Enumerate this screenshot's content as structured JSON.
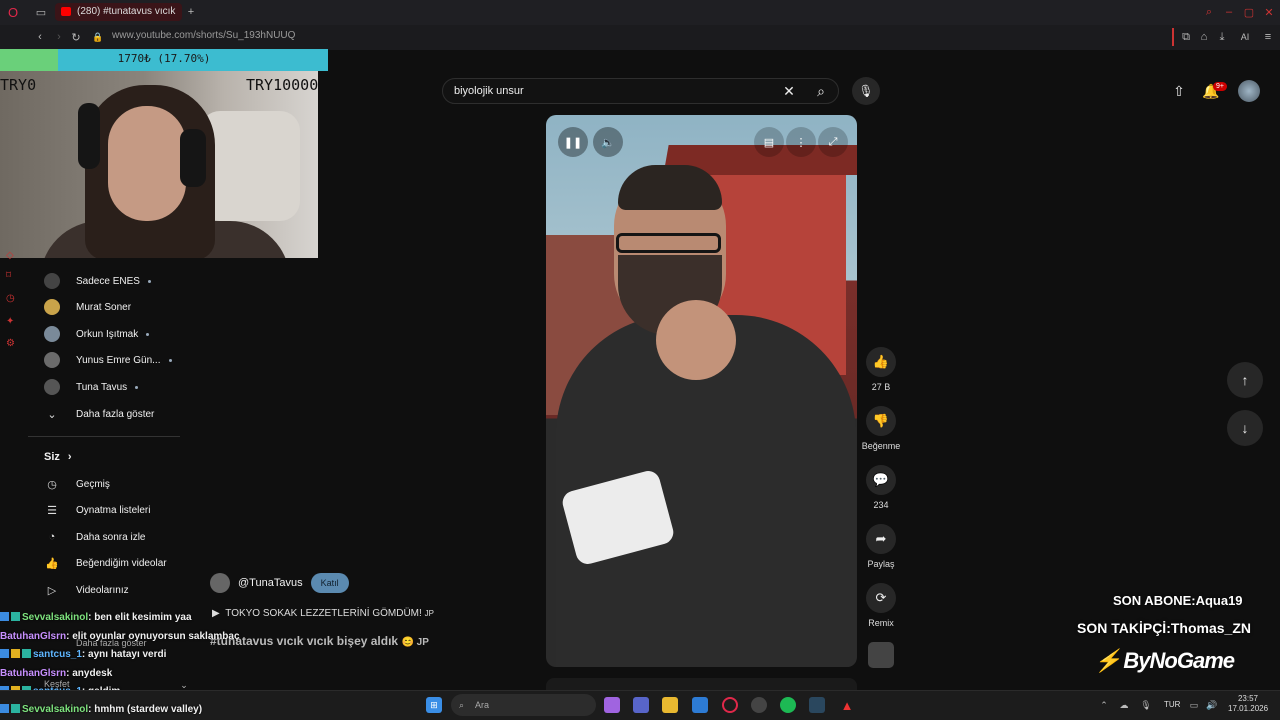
{
  "browser": {
    "tab_title": "(280) #tunatavus vıcık",
    "url": "www.youtube.com/shorts/Su_193hNUUQ",
    "ai_label": "AI"
  },
  "goal": {
    "progress_text": "1770₺ (17.70%)",
    "progress_fraction": 0.177,
    "start_label": "TRY0",
    "end_label": "TRY10000"
  },
  "search": {
    "query": "biyolojik unsur"
  },
  "header": {
    "notification_badge": "9+"
  },
  "sidebar": {
    "subscriptions": [
      {
        "name": "Sadece ENES",
        "dot": true
      },
      {
        "name": "Murat Soner",
        "dot": false
      },
      {
        "name": "Orkun Işıtmak",
        "dot": true
      },
      {
        "name": "Yunus Emre Gün...",
        "dot": true
      },
      {
        "name": "Tuna Tavus",
        "dot": true
      }
    ],
    "show_more": "Daha fazla göster",
    "you_heading": "Siz",
    "you_items": [
      "Geçmiş",
      "Oynatma listeleri",
      "Daha sonra izle",
      "Beğendiğim videolar",
      "Videolarınız"
    ],
    "show_more_2": "Daha fazla göster",
    "explore": "Keşfet"
  },
  "short": {
    "channel": "@TunaTavus",
    "join_label": "Katıl",
    "linked_video": "TOKYO SOKAK LEZZETLERİNİ GÖMDÜM!",
    "title": "#tunatavus vıcık vıcık bişey aldık",
    "title_suffix": "😊 JP",
    "linked_suffix": "JP"
  },
  "actions": {
    "likes": "27 B",
    "dislike_label": "Beğenme",
    "comments": "234",
    "share_label": "Paylaş",
    "remix_label": "Remix"
  },
  "chat": [
    {
      "user": "Sevvalsakinol",
      "msg": ": ben elit kesimim yaa",
      "color": "u1",
      "badges": 2
    },
    {
      "user": "BatuhanGlsrn",
      "msg": ": elit oyunlar oynuyorsun saklambaç",
      "color": "u2",
      "badges": 0
    },
    {
      "user": "santcus_1",
      "msg": ": aynı hatayı verdi",
      "color": "u3",
      "badges": 3
    },
    {
      "user": "BatuhanGlsrn",
      "msg": ": anydesk",
      "color": "u2",
      "badges": 0
    },
    {
      "user": "santcus_1",
      "msg": ": geldim",
      "color": "u3",
      "badges": 3
    },
    {
      "user": "Sevvalsakinol",
      "msg": ": hmhm (stardew valley)",
      "color": "u1",
      "badges": 2
    }
  ],
  "overlay": {
    "last_sub": "SON ABONE:Aqua19",
    "last_follow": "SON TAKİPÇİ:Thomas_ZN",
    "brand": "ByNoGame"
  },
  "taskbar": {
    "search_placeholder": "Ara",
    "lang": "TUR",
    "time": "23:57",
    "date": "17.01.2026"
  }
}
